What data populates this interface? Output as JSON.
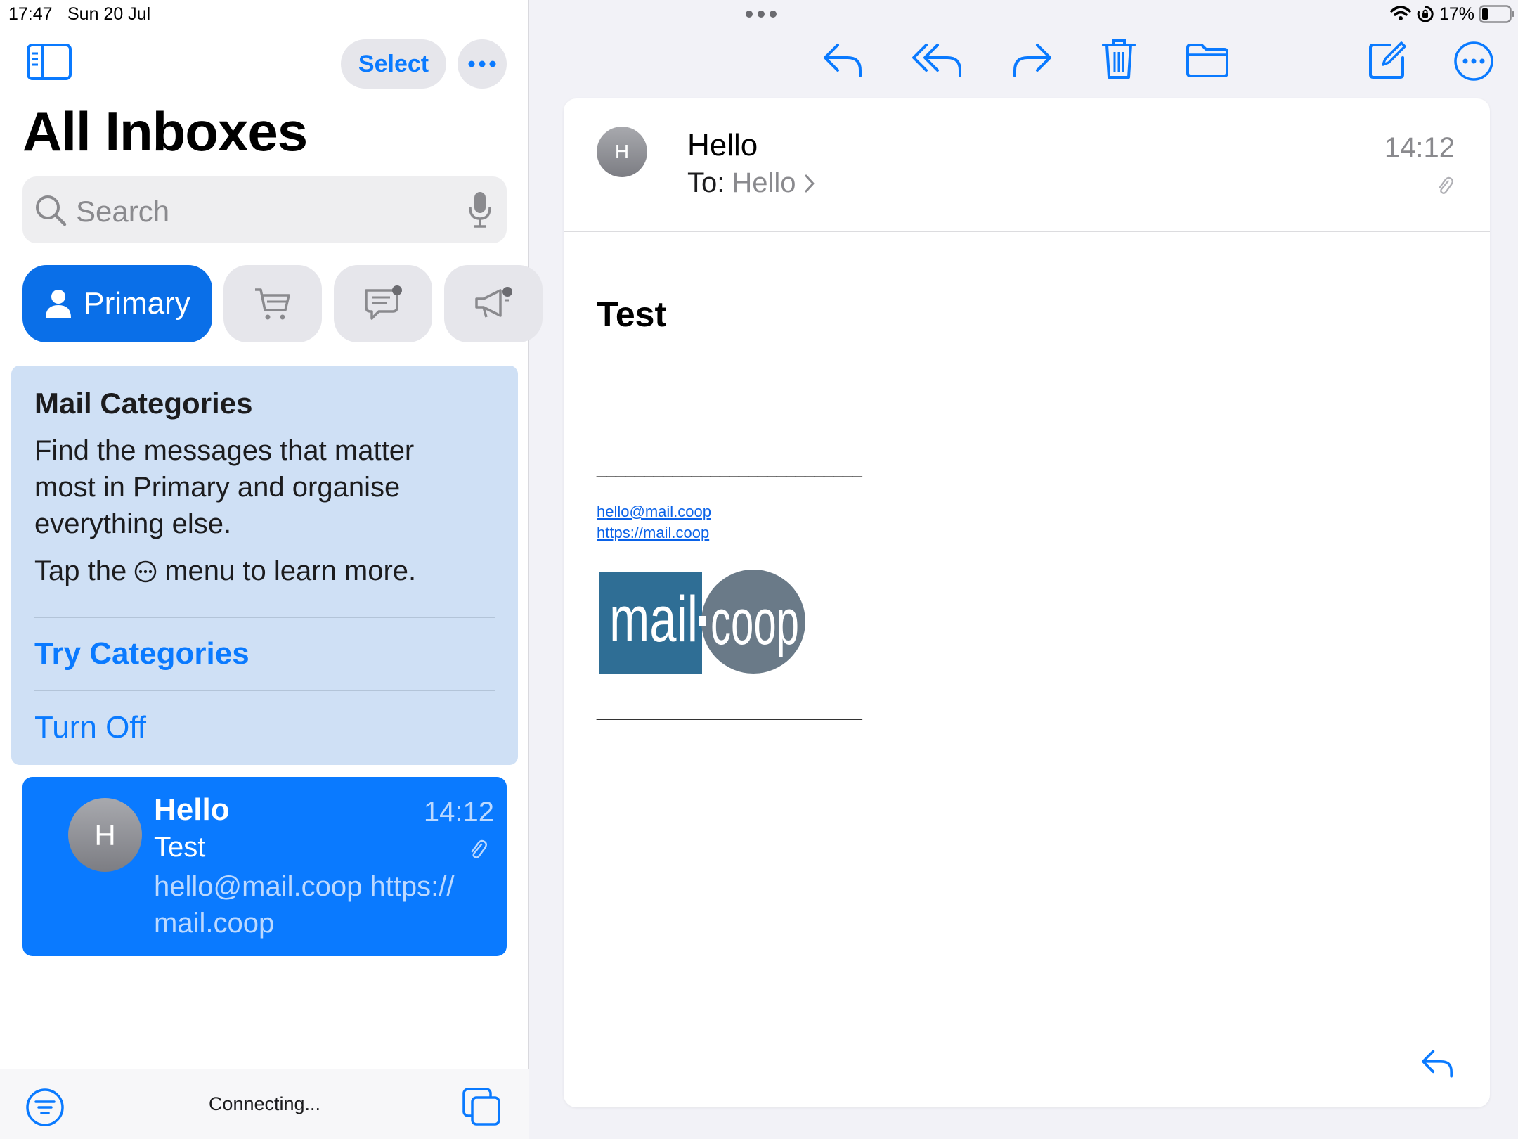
{
  "status": {
    "time": "17:47",
    "date": "Sun 20 Jul",
    "battery": "17%"
  },
  "sidebar": {
    "title": "All Inboxes",
    "select_label": "Select",
    "search_placeholder": "Search",
    "tabs": [
      {
        "label": "Primary",
        "icon": "person-icon",
        "active": true
      },
      {
        "label": "",
        "icon": "cart-icon",
        "active": false
      },
      {
        "label": "",
        "icon": "chat-icon",
        "active": false
      },
      {
        "label": "",
        "icon": "megaphone-icon",
        "active": false
      }
    ],
    "categories_card": {
      "title": "Mail Categories",
      "description": "Find the messages that matter most in Primary and organise everything else.",
      "tap_prefix": "Tap the",
      "tap_suffix": "menu to learn more.",
      "try_label": "Try Categories",
      "off_label": "Turn Off"
    },
    "messages": [
      {
        "avatar_initial": "H",
        "sender": "Hello",
        "time": "14:12",
        "subject": "Test",
        "preview": "hello@mail.coop https:// mail.coop",
        "has_attachment": true,
        "selected": true
      }
    ],
    "bottom_status": "Connecting..."
  },
  "detail": {
    "avatar_initial": "H",
    "sender": "Hello",
    "to_label": "To:",
    "to_value": "Hello",
    "time": "14:12",
    "subject": "Test",
    "signature_line": "____________________________",
    "links": [
      "hello@mail.coop",
      "https://mail.coop"
    ],
    "logo_text_left": "mail",
    "logo_text_right": "coop"
  },
  "colors": {
    "accent": "#0a7aff",
    "card_bg": "#cfe0f5",
    "logo_left": "#2f6e95",
    "logo_right": "#6a7a88"
  }
}
